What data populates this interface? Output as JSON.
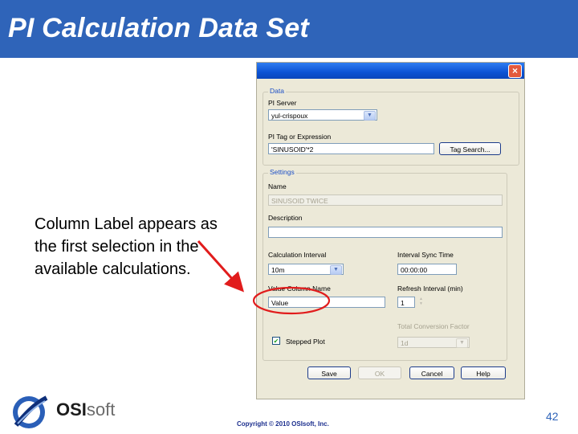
{
  "slide": {
    "title": "PI Calculation Data Set",
    "body_text": "Column Label appears as the first selection in the available calculations.",
    "page_number": "42",
    "copyright": "Copyright © 2010 OSIsoft, Inc.",
    "logo": {
      "name_bold": "OSI",
      "name_light": "soft"
    }
  },
  "dialog": {
    "close_icon": "×",
    "data_group": {
      "legend": "Data",
      "pi_server_label": "PI Server",
      "pi_server_value": "yul-crispoux",
      "tag_label": "PI Tag or Expression",
      "tag_value": "'SINUSOID'*2",
      "tag_search_button": "Tag Search..."
    },
    "settings_group": {
      "legend": "Settings",
      "name_label": "Name",
      "name_value": "SINUSOID TWICE",
      "description_label": "Description",
      "description_value": "",
      "calc_interval_label": "Calculation Interval",
      "calc_interval_value": "10m",
      "sync_time_label": "Interval Sync Time",
      "sync_time_value": "00:00:00",
      "value_column_label": "Value Column Name",
      "value_column_value": "Value",
      "refresh_label": "Refresh Interval (min)",
      "refresh_value": "1",
      "conversion_label": "Total Conversion Factor",
      "conversion_value": "1d",
      "stepped_plot_label": "Stepped Plot",
      "stepped_plot_checked": true
    },
    "buttons": {
      "save": "Save",
      "ok": "OK",
      "cancel": "Cancel",
      "help": "Help"
    }
  },
  "colors": {
    "header_blue": "#2f64b9",
    "dialog_bg": "#ece9d8",
    "annotation_red": "#e11c1c"
  }
}
